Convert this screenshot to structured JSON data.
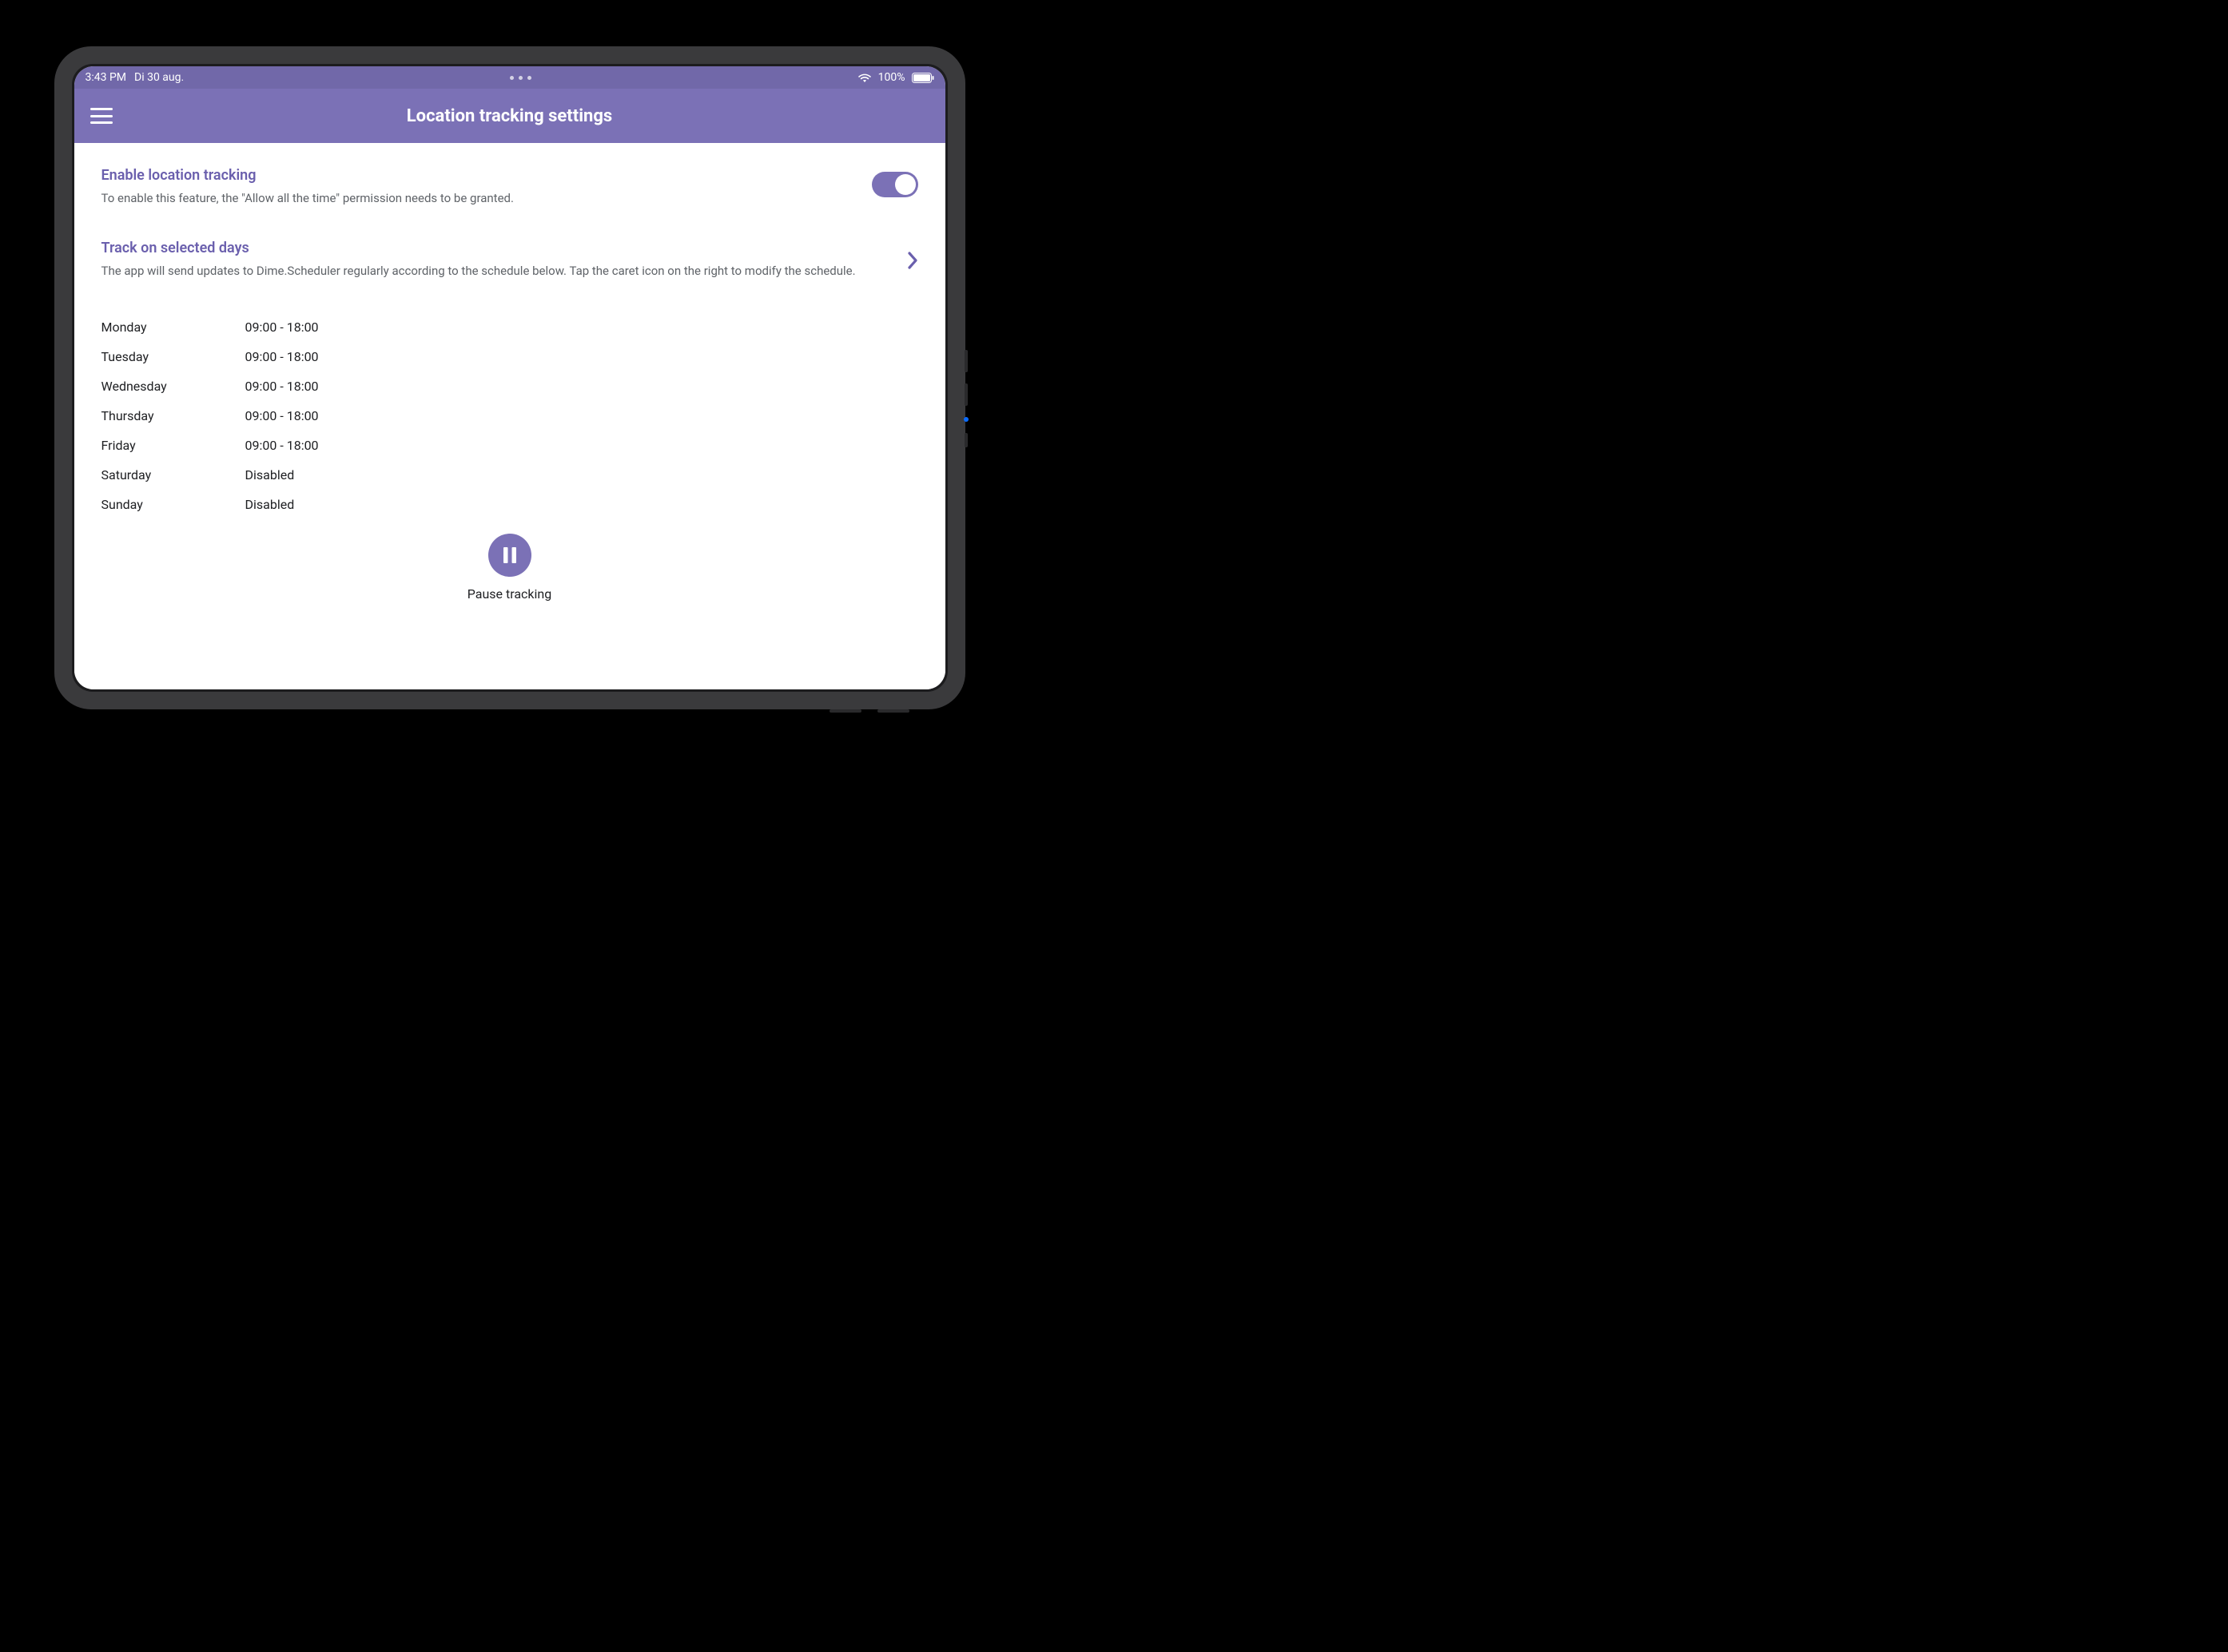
{
  "status_bar": {
    "time": "3:43 PM",
    "date": "Di 30 aug.",
    "battery_pct": "100%"
  },
  "app_bar": {
    "title": "Location tracking settings"
  },
  "enable_section": {
    "title": "Enable location tracking",
    "description": "To enable this feature, the \"Allow all the time\" permission needs to be granted.",
    "toggle_on": true
  },
  "schedule_section": {
    "title": "Track on selected days",
    "description": "The app will send updates to Dime.Scheduler regularly according to the schedule below. Tap the caret icon on the right to modify the schedule.",
    "days": [
      {
        "day": "Monday",
        "time": "09:00 - 18:00"
      },
      {
        "day": "Tuesday",
        "time": "09:00 - 18:00"
      },
      {
        "day": "Wednesday",
        "time": "09:00 - 18:00"
      },
      {
        "day": "Thursday",
        "time": "09:00 - 18:00"
      },
      {
        "day": "Friday",
        "time": "09:00 - 18:00"
      },
      {
        "day": "Saturday",
        "time": "Disabled"
      },
      {
        "day": "Sunday",
        "time": "Disabled"
      }
    ]
  },
  "pause": {
    "label": "Pause tracking"
  },
  "colors": {
    "accent": "#7b71b6",
    "accent_dark": "#6a5fad",
    "status_bar_bg": "#7168a9",
    "text_secondary": "#5f6368"
  }
}
